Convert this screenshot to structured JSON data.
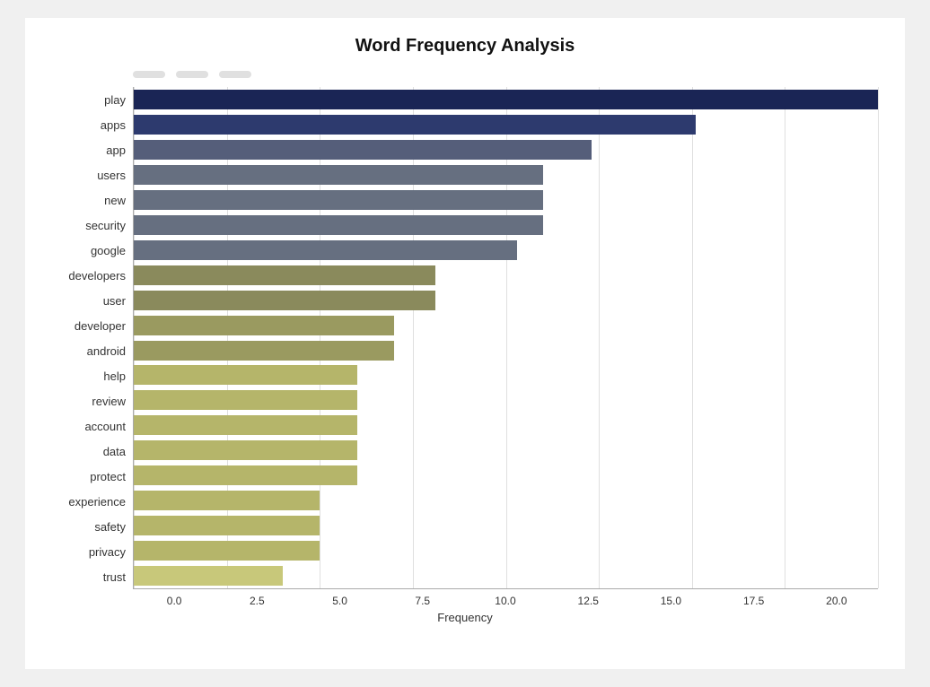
{
  "title": "Word Frequency Analysis",
  "filter_pills": [
    "",
    "",
    ""
  ],
  "x_axis_label": "Frequency",
  "x_ticks": [
    "0.0",
    "2.5",
    "5.0",
    "7.5",
    "10.0",
    "12.5",
    "15.0",
    "17.5",
    "20.0"
  ],
  "max_value": 20.0,
  "bars": [
    {
      "label": "play",
      "value": 20.0,
      "color": "#1a2555"
    },
    {
      "label": "apps",
      "value": 15.1,
      "color": "#2d3a6e"
    },
    {
      "label": "app",
      "value": 12.3,
      "color": "#555e7a"
    },
    {
      "label": "users",
      "value": 11.0,
      "color": "#666f80"
    },
    {
      "label": "new",
      "value": 11.0,
      "color": "#666f80"
    },
    {
      "label": "security",
      "value": 11.0,
      "color": "#666f80"
    },
    {
      "label": "google",
      "value": 10.3,
      "color": "#666f80"
    },
    {
      "label": "developers",
      "value": 8.1,
      "color": "#8a8a5c"
    },
    {
      "label": "user",
      "value": 8.1,
      "color": "#8a8a5c"
    },
    {
      "label": "developer",
      "value": 7.0,
      "color": "#9a9a60"
    },
    {
      "label": "android",
      "value": 7.0,
      "color": "#9a9a60"
    },
    {
      "label": "help",
      "value": 6.0,
      "color": "#b5b56a"
    },
    {
      "label": "review",
      "value": 6.0,
      "color": "#b5b56a"
    },
    {
      "label": "account",
      "value": 6.0,
      "color": "#b5b56a"
    },
    {
      "label": "data",
      "value": 6.0,
      "color": "#b5b56a"
    },
    {
      "label": "protect",
      "value": 6.0,
      "color": "#b5b56a"
    },
    {
      "label": "experience",
      "value": 5.0,
      "color": "#b5b56a"
    },
    {
      "label": "safety",
      "value": 5.0,
      "color": "#b5b56a"
    },
    {
      "label": "privacy",
      "value": 5.0,
      "color": "#b5b56a"
    },
    {
      "label": "trust",
      "value": 4.0,
      "color": "#c8c87a"
    }
  ]
}
